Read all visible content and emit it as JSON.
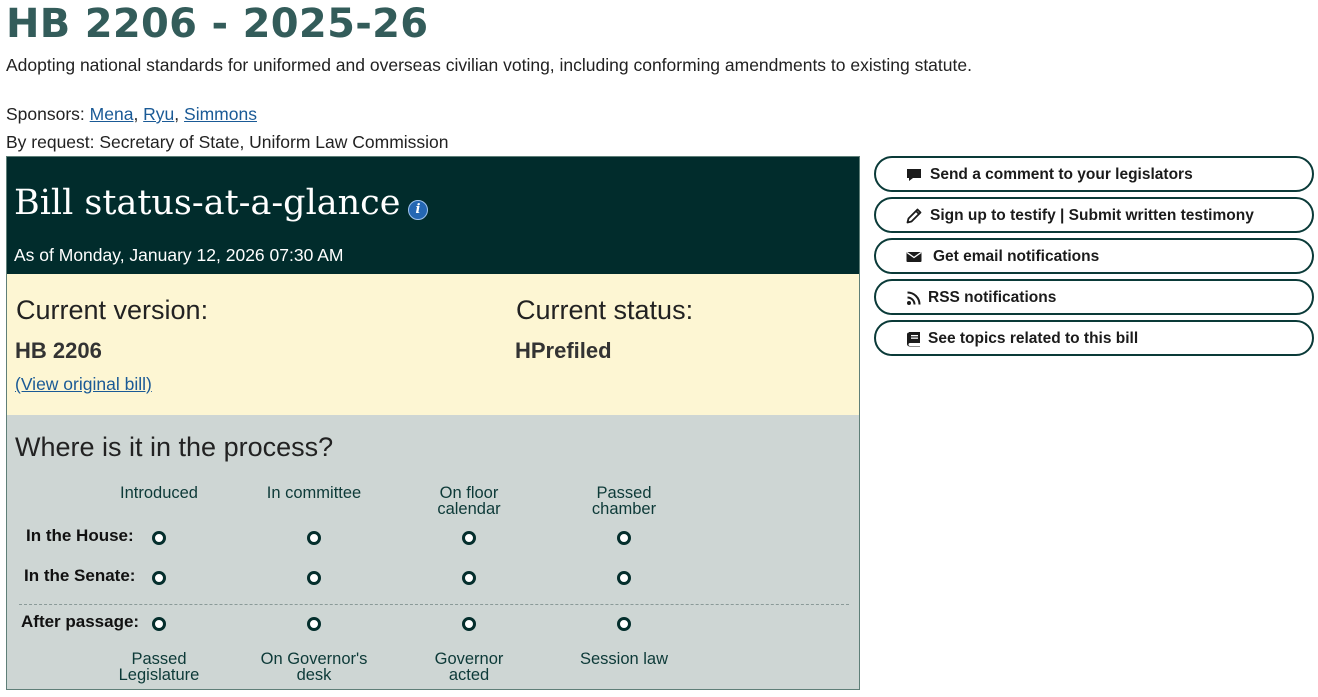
{
  "bill": {
    "title": "HB 2206 - 2025-26",
    "description": "Adopting national standards for uniformed and overseas civilian voting, including conforming amendments to existing statute.",
    "sponsors_label": "Sponsors: ",
    "sponsors": [
      "Mena",
      "Ryu",
      "Simmons"
    ],
    "sponsor_separator": ", ",
    "by_request": "By request: Secretary of State, Uniform Law Commission"
  },
  "status_panel": {
    "title": "Bill status-at-a-glance",
    "info_icon_glyph": "i",
    "as_of": "As of Monday, January 12, 2026 07:30 AM",
    "current_version_label": "Current version:",
    "current_version": "HB 2206",
    "view_original_link": "(View original bill)",
    "current_status_label": "Current status:",
    "current_status": "HPrefiled"
  },
  "process": {
    "title": "Where is it in the process?",
    "top_stages": [
      [
        "Introduced"
      ],
      [
        "In committee"
      ],
      [
        "On floor",
        "calendar"
      ],
      [
        "Passed",
        "chamber"
      ]
    ],
    "rows": [
      "In the House:",
      "In the Senate:",
      "After passage:"
    ],
    "bottom_stages": [
      [
        "Passed",
        "Legislature"
      ],
      [
        "On Governor's",
        "desk"
      ],
      [
        "Governor",
        "acted"
      ],
      [
        "Session law"
      ]
    ]
  },
  "actions": [
    {
      "label": "Send a comment to your legislators",
      "icon": "comment-icon"
    },
    {
      "label": "Sign up to testify | Submit written testimony",
      "icon": "pencil-icon"
    },
    {
      "label": "Get email notifications",
      "icon": "envelope-icon"
    },
    {
      "label": "RSS notifications",
      "icon": "rss-icon"
    },
    {
      "label": "See topics related to this bill",
      "icon": "book-icon"
    }
  ],
  "colors": {
    "title": "#335c5a",
    "header_bg": "#012c2c",
    "version_bg": "#fdf6d3",
    "process_bg": "#ced6d4",
    "link": "#1a5a96"
  }
}
